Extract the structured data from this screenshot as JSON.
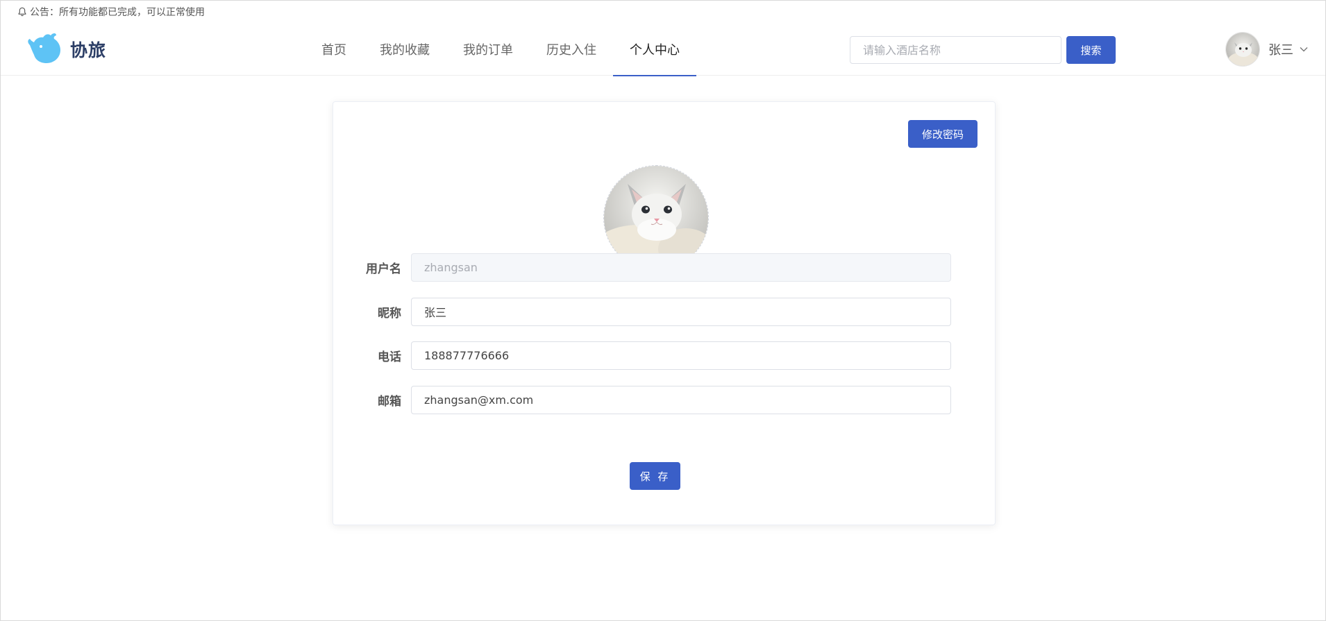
{
  "notice": {
    "text": "公告：所有功能都已完成，可以正常使用",
    "icon": "bell-icon"
  },
  "header": {
    "logo_text": "协旅",
    "logo_icon": "whale-icon",
    "nav": [
      {
        "label": "首页",
        "active": false
      },
      {
        "label": "我的收藏",
        "active": false
      },
      {
        "label": "我的订单",
        "active": false
      },
      {
        "label": "历史入住",
        "active": false
      },
      {
        "label": "个人中心",
        "active": true
      }
    ],
    "search": {
      "placeholder": "请输入酒店名称",
      "value": "",
      "button_label": "搜索"
    },
    "user": {
      "name": "张三",
      "avatar": "cat-avatar",
      "dropdown_icon": "chevron-down-icon"
    }
  },
  "profile": {
    "change_password_label": "修改密码",
    "avatar": "cat-avatar",
    "fields": {
      "username": {
        "label": "用户名",
        "value": "zhangsan",
        "disabled": true
      },
      "nickname": {
        "label": "昵称",
        "value": "张三"
      },
      "phone": {
        "label": "电话",
        "value": "188877776666"
      },
      "email": {
        "label": "邮箱",
        "value": "zhangsan@xm.com"
      }
    },
    "save_label": "保 存"
  },
  "colors": {
    "primary": "#3a5fc8",
    "logo_blue": "#5ec3f5",
    "logo_text": "#2c3e66"
  }
}
